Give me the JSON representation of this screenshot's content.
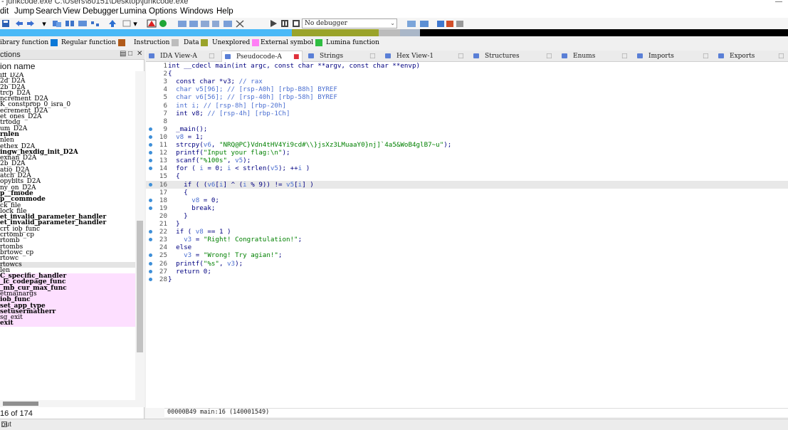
{
  "window": {
    "title": "- junkcode.exe C:\\Users\\80151\\Desktop\\junkcode.exe"
  },
  "menu": [
    "dit",
    "Jump",
    "Search",
    "View",
    "Debugger",
    "Lumina",
    "Options",
    "Windows",
    "Help"
  ],
  "toolbar": {
    "debugger_select": "No debugger"
  },
  "legend": [
    {
      "label": "ibrary function",
      "color": "#49c5ff"
    },
    {
      "label": "Regular function",
      "color": "#0a78d7"
    },
    {
      "label": "Instruction",
      "color": "#b05a1a"
    },
    {
      "label": "Data",
      "color": "#bdbdbd"
    },
    {
      "label": "Unexplored",
      "color": "#9aa32a"
    },
    {
      "label": "External symbol",
      "color": "#ff7ff5"
    },
    {
      "label": "Lumina function",
      "color": "#2fbe42"
    }
  ],
  "functions_panel": {
    "title": "ctions",
    "column_header": "ion name",
    "count_label": "16 of 174",
    "items": [
      {
        "name": "iff_D2A"
      },
      {
        "name": "2d_D2A"
      },
      {
        "name": "2b_D2A"
      },
      {
        "name": "trcp_D2A"
      },
      {
        "name": "ncrement_D2A"
      },
      {
        "name": "K_constprop_0_isra_0"
      },
      {
        "name": "ecrement_D2A"
      },
      {
        "name": "et_ones_D2A"
      },
      {
        "name": "trtodg"
      },
      {
        "name": "um_D2A"
      },
      {
        "name": "rnlen",
        "bold": true
      },
      {
        "name": "nlen"
      },
      {
        "name": "ethex_D2A"
      },
      {
        "name": "ingw_hexdig_init_D2A",
        "bold": true
      },
      {
        "name": "exnan_D2A"
      },
      {
        "name": "2b_D2A"
      },
      {
        "name": "atio_D2A"
      },
      {
        "name": "atch_D2A"
      },
      {
        "name": "opybits_D2A"
      },
      {
        "name": "ny_on_D2A"
      },
      {
        "name": "p__fmode",
        "bold": true
      },
      {
        "name": "p__commode",
        "bold": true
      },
      {
        "name": "ck_file"
      },
      {
        "name": "lock_file"
      },
      {
        "name": "et_invalid_parameter_handler",
        "bold": true
      },
      {
        "name": "et_invalid_parameter_handler",
        "bold": true
      },
      {
        "name": "crt_iob_func"
      },
      {
        "name": "crtomb_cp"
      },
      {
        "name": "rtomb"
      },
      {
        "name": "rtombs"
      },
      {
        "name": "brtowc_cp"
      },
      {
        "name": "rtowc"
      },
      {
        "name": "rtowcs",
        "selected": true
      },
      {
        "name": "len"
      },
      {
        "name": "C_specific_handler",
        "bold": true,
        "external": true
      },
      {
        "name": "_lc_codepage_func",
        "bold": true,
        "external": true
      },
      {
        "name": "_mb_cur_max_func",
        "bold": true,
        "external": true
      },
      {
        "name": "etmainargs",
        "external": true
      },
      {
        "name": "iob_func",
        "bold": true,
        "external": true
      },
      {
        "name": "set_app_type",
        "bold": true,
        "external": true
      },
      {
        "name": "setusermatherr",
        "bold": true,
        "external": true
      },
      {
        "name": "sg_exit",
        "external": true
      },
      {
        "name": "exit",
        "bold": true,
        "external": true
      }
    ]
  },
  "tabs": [
    {
      "label": "IDA View-A",
      "color": "#5a7fd6",
      "active": false
    },
    {
      "label": "Pseudocode-A",
      "color": "#5a7fd6",
      "active": true
    },
    {
      "label": "Strings",
      "color": "#5a7fd6",
      "active": false
    },
    {
      "label": "Hex View-1",
      "color": "#5a7fd6",
      "active": false
    },
    {
      "label": "Structures",
      "color": "#5a7fd6",
      "active": false
    },
    {
      "label": "Enums",
      "color": "#5a7fd6",
      "active": false
    },
    {
      "label": "Imports",
      "color": "#5a7fd6",
      "active": false
    },
    {
      "label": "Exports",
      "color": "#5a7fd6",
      "active": false
    }
  ],
  "code": {
    "lines": [
      {
        "n": "1",
        "dot": false,
        "parts": [
          {
            "t": "int __cdecl main(int argc, const char **argv, const char **envp)",
            "c": "k"
          }
        ]
      },
      {
        "n": "2",
        "dot": false,
        "parts": [
          {
            "t": "{",
            "c": "k"
          }
        ]
      },
      {
        "n": "3",
        "dot": false,
        "parts": [
          {
            "t": "  const char *v3; ",
            "c": "k"
          },
          {
            "t": "// rax",
            "c": "cm"
          }
        ]
      },
      {
        "n": "4",
        "dot": false,
        "parts": [
          {
            "t": "  char v5[96]; ",
            "c": "cm"
          },
          {
            "t": "// [rsp-A0h] [rbp-B8h] BYREF",
            "c": "cm"
          }
        ]
      },
      {
        "n": "5",
        "dot": false,
        "parts": [
          {
            "t": "  char v6[56]; ",
            "c": "cm"
          },
          {
            "t": "// [rsp-40h] [rbp-58h] BYREF",
            "c": "cm"
          }
        ]
      },
      {
        "n": "6",
        "dot": false,
        "parts": [
          {
            "t": "  int i; ",
            "c": "cm"
          },
          {
            "t": "// [rsp-8h] [rbp-20h]",
            "c": "cm"
          }
        ]
      },
      {
        "n": "7",
        "dot": false,
        "parts": [
          {
            "t": "  int v8; ",
            "c": "k"
          },
          {
            "t": "// [rsp-4h] [rbp-1Ch]",
            "c": "cm"
          }
        ]
      },
      {
        "n": "8",
        "dot": false,
        "parts": [
          {
            "t": "",
            "c": "k"
          }
        ]
      },
      {
        "n": "9",
        "dot": true,
        "parts": [
          {
            "t": "  _main();",
            "c": "k"
          }
        ]
      },
      {
        "n": "10",
        "dot": true,
        "parts": [
          {
            "t": "  v8",
            "c": "var"
          },
          {
            "t": " = 1;",
            "c": "k"
          }
        ]
      },
      {
        "n": "11",
        "dot": true,
        "parts": [
          {
            "t": "  strcpy(",
            "c": "k"
          },
          {
            "t": "v6",
            "c": "var"
          },
          {
            "t": ", ",
            "c": "k"
          },
          {
            "t": "\"NRQ@PC}Vdn4tHV4Yi9cd#\\\\}jsXz3LMuaaY0}nj]`4a5&WoB4glB7~u\"",
            "c": "str"
          },
          {
            "t": ");",
            "c": "k"
          }
        ]
      },
      {
        "n": "12",
        "dot": true,
        "parts": [
          {
            "t": "  printf(",
            "c": "k"
          },
          {
            "t": "\"Input your flag:\\n\"",
            "c": "str"
          },
          {
            "t": ");",
            "c": "k"
          }
        ]
      },
      {
        "n": "13",
        "dot": true,
        "parts": [
          {
            "t": "  scanf(",
            "c": "k"
          },
          {
            "t": "\"%100s\"",
            "c": "str"
          },
          {
            "t": ", ",
            "c": "k"
          },
          {
            "t": "v5",
            "c": "var"
          },
          {
            "t": ");",
            "c": "k"
          }
        ]
      },
      {
        "n": "14",
        "dot": true,
        "parts": [
          {
            "t": "  for ( ",
            "c": "k"
          },
          {
            "t": "i",
            "c": "var"
          },
          {
            "t": " = 0; ",
            "c": "k"
          },
          {
            "t": "i",
            "c": "var"
          },
          {
            "t": " < strlen(",
            "c": "k"
          },
          {
            "t": "v5",
            "c": "var"
          },
          {
            "t": "); ++",
            "c": "k"
          },
          {
            "t": "i",
            "c": "var"
          },
          {
            "t": " )",
            "c": "k"
          }
        ]
      },
      {
        "n": "15",
        "dot": false,
        "parts": [
          {
            "t": "  {",
            "c": "k"
          }
        ]
      },
      {
        "n": "16",
        "dot": true,
        "hl": true,
        "parts": [
          {
            "t": "    if ( (",
            "c": "k"
          },
          {
            "t": "v6",
            "c": "var"
          },
          {
            "t": "[",
            "c": "k"
          },
          {
            "t": "i",
            "c": "var"
          },
          {
            "t": "] ^ (",
            "c": "k"
          },
          {
            "t": "i",
            "c": "var"
          },
          {
            "t": " % 9)) != ",
            "c": "k"
          },
          {
            "t": "v5",
            "c": "var"
          },
          {
            "t": "[",
            "c": "k"
          },
          {
            "t": "i",
            "c": "var"
          },
          {
            "t": "] )",
            "c": "k"
          }
        ]
      },
      {
        "n": "17",
        "dot": false,
        "parts": [
          {
            "t": "    {",
            "c": "k"
          }
        ]
      },
      {
        "n": "18",
        "dot": true,
        "parts": [
          {
            "t": "      v8",
            "c": "var"
          },
          {
            "t": " = 0;",
            "c": "k"
          }
        ]
      },
      {
        "n": "19",
        "dot": true,
        "parts": [
          {
            "t": "      break;",
            "c": "k"
          }
        ]
      },
      {
        "n": "20",
        "dot": false,
        "parts": [
          {
            "t": "    }",
            "c": "k"
          }
        ]
      },
      {
        "n": "21",
        "dot": false,
        "parts": [
          {
            "t": "  }",
            "c": "k"
          }
        ]
      },
      {
        "n": "22",
        "dot": true,
        "parts": [
          {
            "t": "  if ( ",
            "c": "k"
          },
          {
            "t": "v8",
            "c": "var"
          },
          {
            "t": " == 1 )",
            "c": "k"
          }
        ]
      },
      {
        "n": "23",
        "dot": true,
        "parts": [
          {
            "t": "    v3",
            "c": "var"
          },
          {
            "t": " = ",
            "c": "k"
          },
          {
            "t": "\"Right! Congratulation!\"",
            "c": "str"
          },
          {
            "t": ";",
            "c": "k"
          }
        ]
      },
      {
        "n": "24",
        "dot": false,
        "parts": [
          {
            "t": "  else",
            "c": "k"
          }
        ]
      },
      {
        "n": "25",
        "dot": true,
        "parts": [
          {
            "t": "    v3",
            "c": "var"
          },
          {
            "t": " = ",
            "c": "k"
          },
          {
            "t": "\"Wrong! Try agian!\"",
            "c": "str"
          },
          {
            "t": ";",
            "c": "k"
          }
        ]
      },
      {
        "n": "26",
        "dot": true,
        "parts": [
          {
            "t": "  printf(",
            "c": "k"
          },
          {
            "t": "\"%s\"",
            "c": "str"
          },
          {
            "t": ", ",
            "c": "k"
          },
          {
            "t": "v3",
            "c": "var"
          },
          {
            "t": ");",
            "c": "k"
          }
        ]
      },
      {
        "n": "27",
        "dot": true,
        "parts": [
          {
            "t": "  return 0;",
            "c": "k"
          }
        ]
      },
      {
        "n": "28",
        "dot": true,
        "parts": [
          {
            "t": "}",
            "c": "k"
          }
        ]
      }
    ]
  },
  "status": {
    "address_line": "00000B49 main:16 (140001549)"
  },
  "output": {
    "label": "out"
  }
}
